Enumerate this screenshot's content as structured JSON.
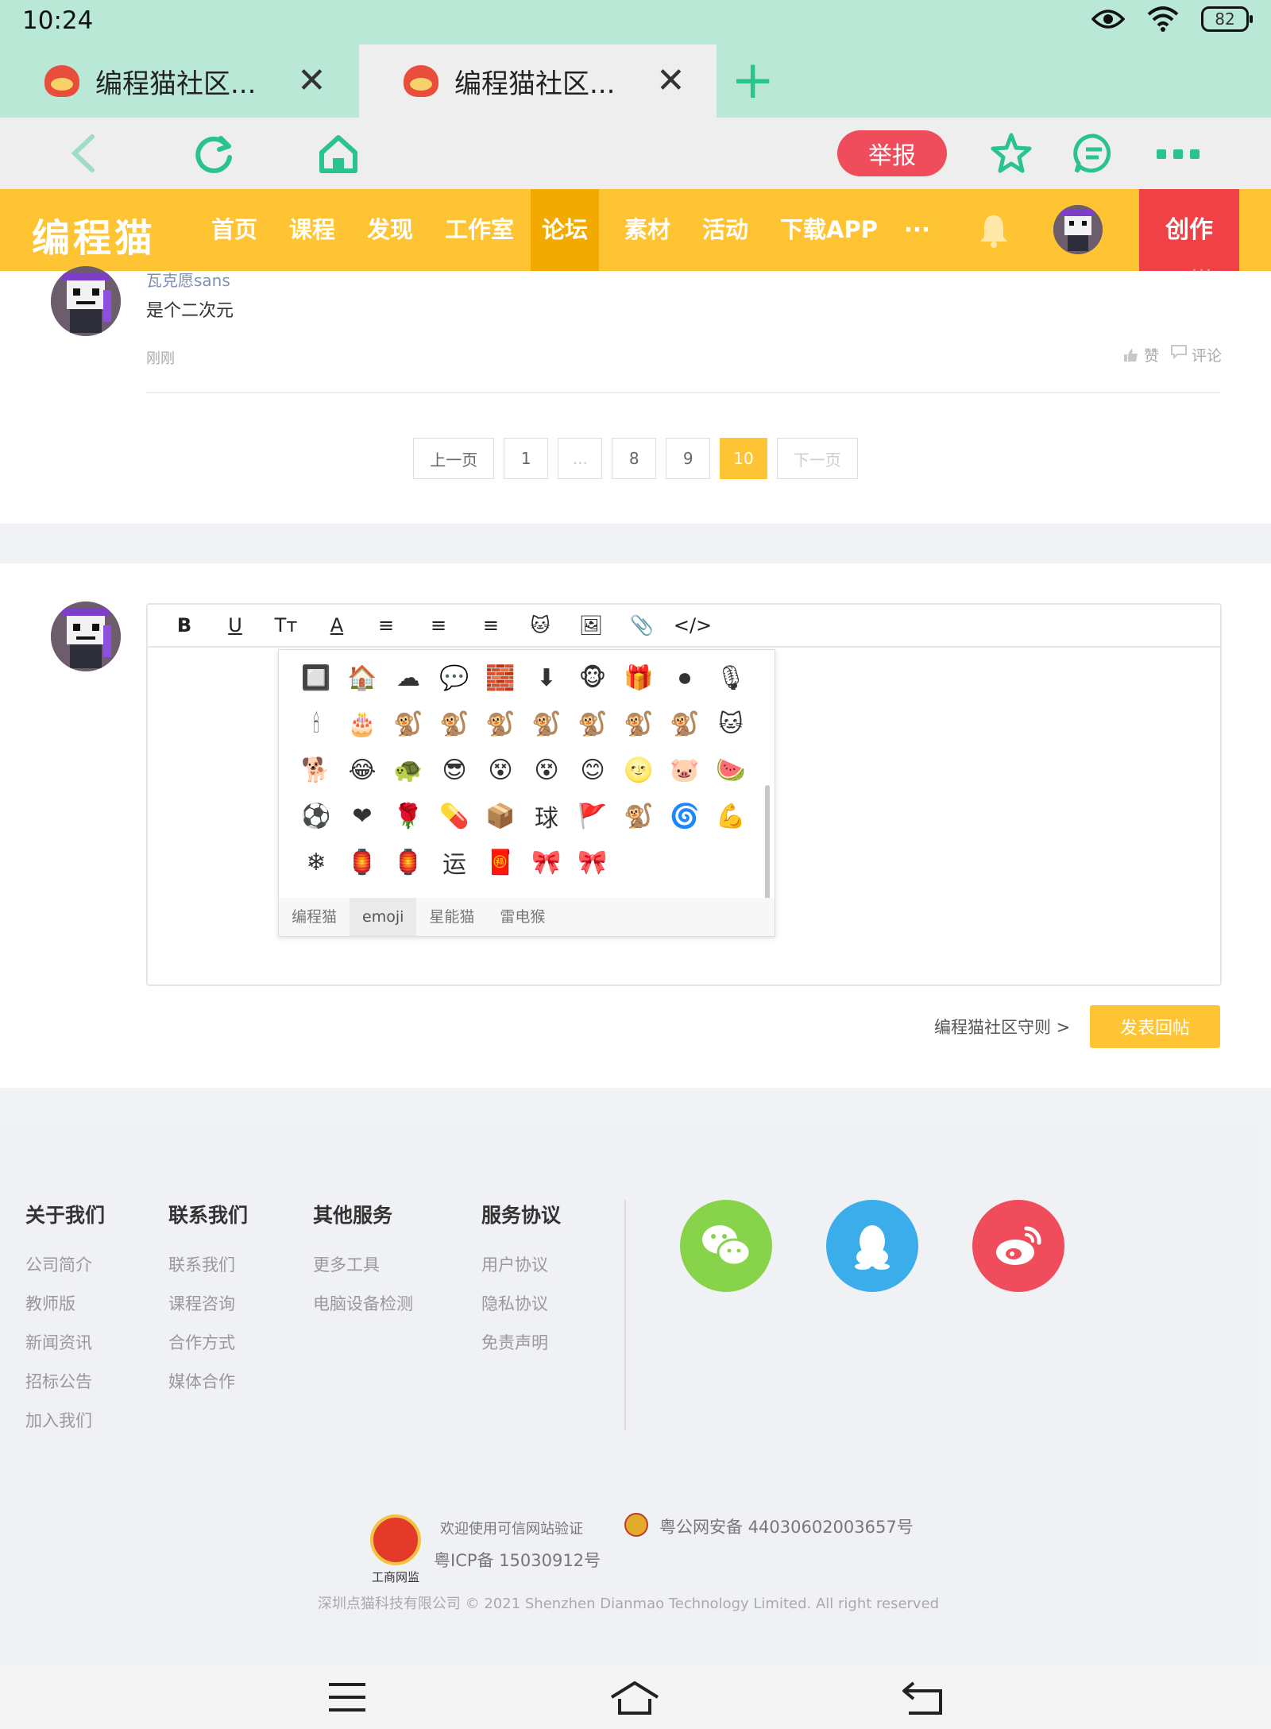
{
  "status": {
    "time": "10:24",
    "battery": "82"
  },
  "tabs": [
    {
      "title": "编程猫社区...",
      "close": "✕"
    },
    {
      "title": "编程猫社区...",
      "close": "✕"
    }
  ],
  "new_tab": "+",
  "toolbar": {
    "report_label": "举报"
  },
  "header": {
    "logo": "编程猫",
    "nav": [
      "首页",
      "课程",
      "发现",
      "工作室",
      "论坛",
      "素材",
      "活动",
      "下载APP",
      "···"
    ],
    "active_nav": "论坛",
    "create_label": "创作"
  },
  "comment": {
    "username": "瓦克愿sans",
    "text": "是个二次元",
    "time": "刚刚",
    "more": "···",
    "like": "赞",
    "reply": "评论"
  },
  "pagination": {
    "prev": "上一页",
    "pages": [
      "1",
      "...",
      "8",
      "9",
      "10"
    ],
    "current": "10",
    "next": "下一页"
  },
  "editor": {
    "tools": [
      "B",
      "U",
      "Tт",
      "A",
      "≡",
      "≡",
      "≡",
      "🐱",
      "🖼",
      "📎",
      "</>"
    ],
    "emoji_rows": [
      [
        "🔲",
        "🏠",
        "☁",
        "💬",
        "🧱",
        "⬇",
        "🐵",
        "🎁",
        "⏺",
        "🎙"
      ],
      [
        "🕯",
        "🎂",
        "🐒",
        "🐒",
        "🐒",
        "🐒",
        "🐒",
        "🐒",
        "🐒",
        "🐱"
      ],
      [
        "🐕",
        "😂",
        "🐢",
        "😎",
        "😵",
        "😵",
        "😊",
        "🌝",
        "🐷",
        "🍉"
      ],
      [
        "⚽",
        "❤",
        "🌹",
        "💊",
        "📦",
        "球",
        "🚩",
        "🐒",
        "🌀",
        "💪"
      ],
      [
        "❄",
        "🏮",
        "🏮",
        "运",
        "🧧",
        "🎀",
        "🎀"
      ]
    ],
    "emoji_tabs": [
      "编程猫",
      "emoji",
      "星能猫",
      "雷电猴"
    ],
    "active_emoji_tab": "emoji",
    "rules_link": "编程猫社区守则 >",
    "submit_label": "发表回帖"
  },
  "footer": {
    "columns": [
      {
        "title": "关于我们",
        "links": [
          "公司简介",
          "教师版",
          "新闻资讯",
          "招标公告",
          "加入我们"
        ]
      },
      {
        "title": "联系我们",
        "links": [
          "联系我们",
          "课程咨询",
          "合作方式",
          "媒体合作"
        ]
      },
      {
        "title": "其他服务",
        "links": [
          "更多工具",
          "电脑设备检测"
        ]
      },
      {
        "title": "服务协议",
        "links": [
          "用户协议",
          "隐私协议",
          "免责声明"
        ]
      }
    ],
    "badge_label": "工商网监",
    "trust_text": "欢迎使用可信网站验证",
    "icp": "粤ICP备 15030912号",
    "police": "粤公网安备 44030602003657号",
    "copyright": "深圳点猫科技有限公司   © 2021 Shenzhen Dianmao Technology Limited. All right reserved"
  },
  "colors": {
    "brand": "#fec433",
    "brand_dark": "#f2a900",
    "create": "#f04246",
    "report": "#ef4d5b",
    "browser_accent": "#2ac28d"
  }
}
